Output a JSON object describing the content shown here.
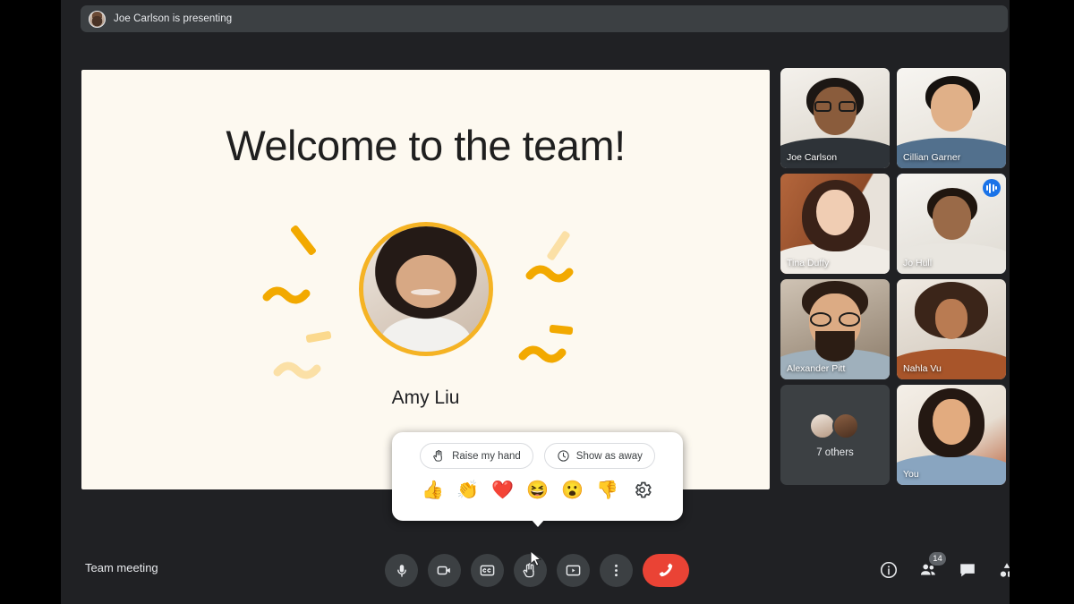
{
  "meta": {
    "app": "Google Meet",
    "bg_color": "#202124",
    "accent_blue": "#1a73e8",
    "hangup_red": "#ea4335",
    "slide_bg": "#fdf9f0",
    "slide_accent": "#f2a900"
  },
  "presenting_bar": {
    "text": "Joe Carlson is presenting",
    "avatar_name": "joe-carlson-avatar"
  },
  "slide": {
    "title": "Welcome to the team!",
    "person_name": "Amy Liu"
  },
  "reactions_popup": {
    "raise_hand_label": "Raise my hand",
    "show_away_label": "Show as away",
    "raise_hand_icon": "raised-hand-icon",
    "show_away_icon": "clock-icon",
    "emojis": [
      {
        "name": "thumbs-up-reaction",
        "glyph": "👍"
      },
      {
        "name": "clapping-hands-reaction",
        "glyph": "👏"
      },
      {
        "name": "red-heart-reaction",
        "glyph": "❤️"
      },
      {
        "name": "laughing-face-reaction",
        "glyph": "😆"
      },
      {
        "name": "surprised-face-reaction",
        "glyph": "😮"
      },
      {
        "name": "thumbs-down-reaction",
        "glyph": "👎"
      }
    ],
    "settings_icon": "gear-icon"
  },
  "participants": [
    {
      "name": "Joe Carlson",
      "active": false,
      "speaking": false
    },
    {
      "name": "Cillian Garner",
      "active": false,
      "speaking": false
    },
    {
      "name": "Tina Duffy",
      "active": false,
      "speaking": false
    },
    {
      "name": "Jo Hull",
      "active": true,
      "speaking": true
    },
    {
      "name": "Alexander Pitt",
      "active": false,
      "speaking": false
    },
    {
      "name": "Nahla Vu",
      "active": false,
      "speaking": false
    },
    {
      "name": "7 others",
      "active": false,
      "speaking": false,
      "is_overflow": true
    },
    {
      "name": "You",
      "active": false,
      "speaking": false
    }
  ],
  "bottom_bar": {
    "meeting_name": "Team meeting",
    "controls": [
      {
        "name": "microphone-button",
        "label": "Turn off microphone"
      },
      {
        "name": "camera-button",
        "label": "Turn off camera"
      },
      {
        "name": "captions-button",
        "label": "Turn on captions"
      },
      {
        "name": "reactions-button",
        "label": "Send a reaction"
      },
      {
        "name": "present-now-button",
        "label": "Present now"
      },
      {
        "name": "more-options-button",
        "label": "More options"
      },
      {
        "name": "leave-call-button",
        "label": "Leave call"
      }
    ],
    "right_icons": [
      {
        "name": "meeting-details-icon",
        "label": "Meeting details",
        "badge": ""
      },
      {
        "name": "people-icon",
        "label": "Show everyone",
        "badge": "14"
      },
      {
        "name": "chat-icon",
        "label": "Chat with everyone",
        "badge": ""
      },
      {
        "name": "activities-icon",
        "label": "Activities",
        "badge": ""
      }
    ]
  }
}
